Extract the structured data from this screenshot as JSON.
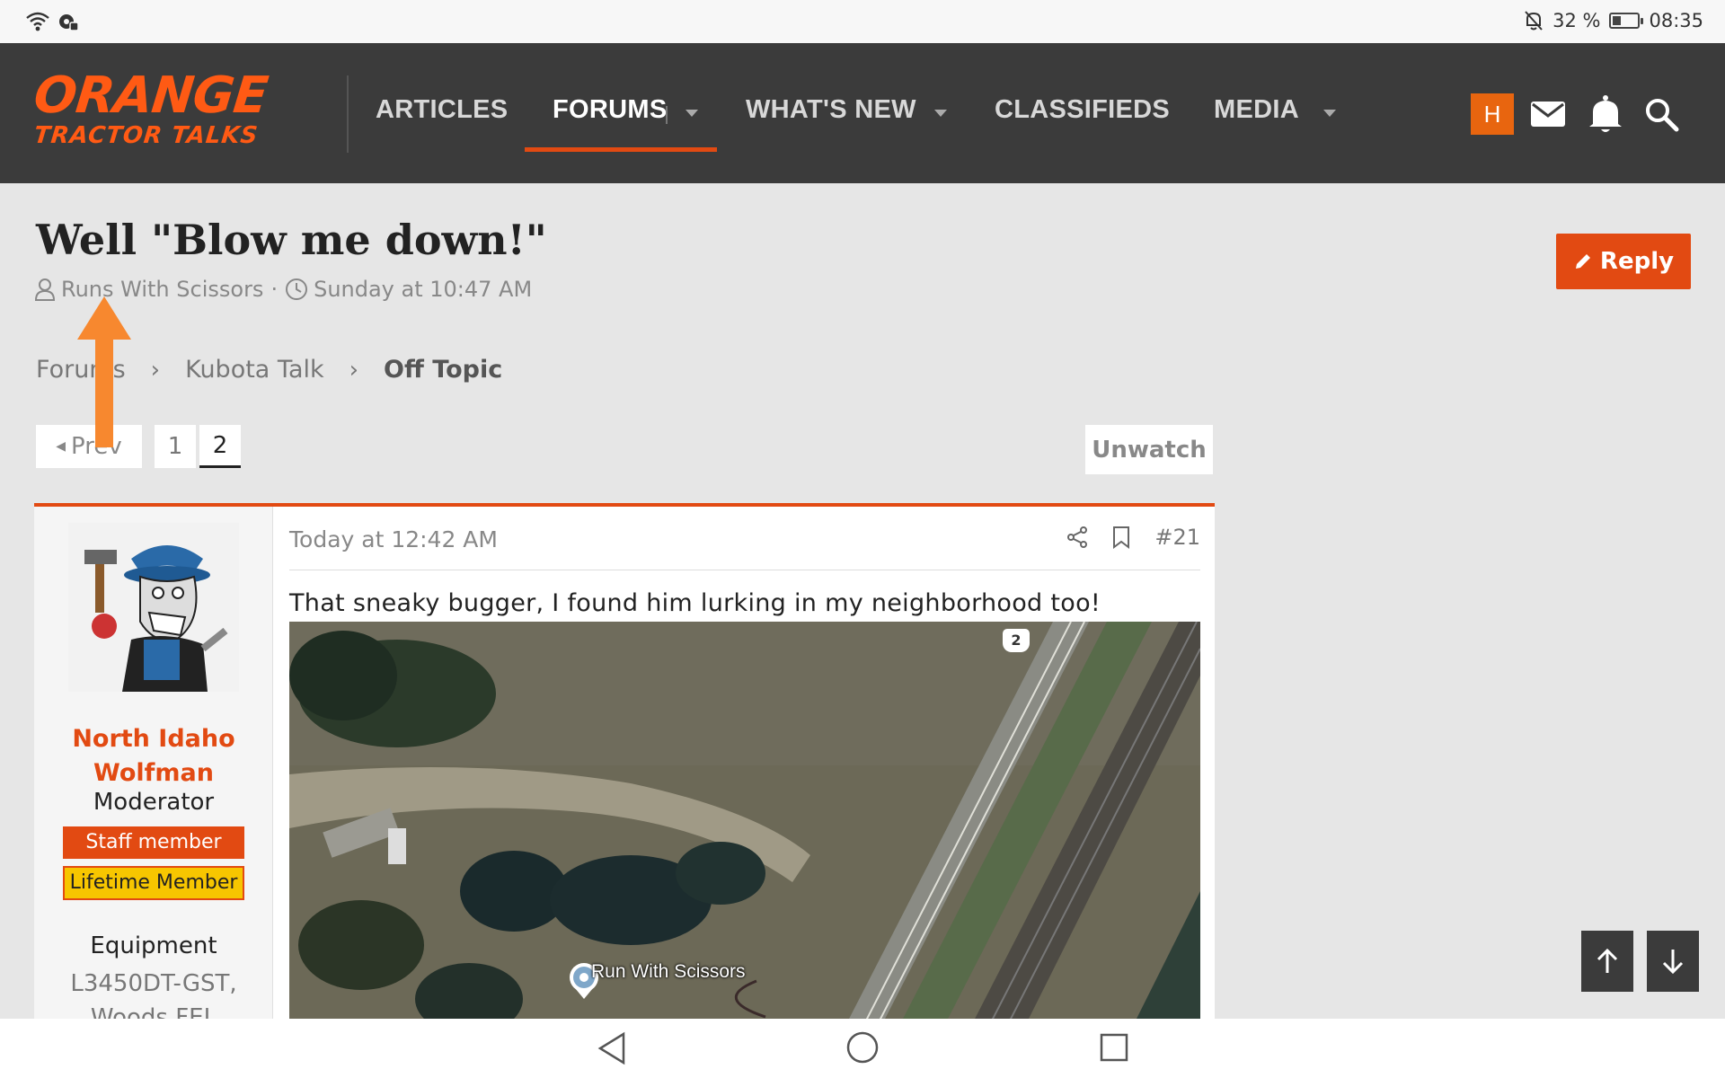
{
  "status_bar": {
    "battery_text": "32 %",
    "battery_level": 0.32,
    "time": "08:35"
  },
  "nav": {
    "logo_top": "ORANGE",
    "logo_bottom": "TRACTOR TALKS",
    "items": [
      {
        "label": "ARTICLES",
        "has_dropdown": false
      },
      {
        "label": "FORUMS",
        "has_dropdown": true,
        "active": true
      },
      {
        "label": "WHAT'S NEW",
        "has_dropdown": true
      },
      {
        "label": "CLASSIFIEDS",
        "has_dropdown": false
      },
      {
        "label": "MEDIA",
        "has_dropdown": true
      }
    ],
    "avatar_letter": "H",
    "icons": [
      "mail-icon",
      "bell-icon",
      "search-icon"
    ],
    "accent_color": "#e24a12"
  },
  "thread": {
    "title": "Well \"Blow me down!\"",
    "author": "Runs With Scissors",
    "separator": "·",
    "date": "Sunday at 10:47 AM",
    "reply_label": "Reply"
  },
  "breadcrumb": {
    "items": [
      "Forums",
      "Kubota Talk"
    ],
    "current": "Off Topic"
  },
  "pagination": {
    "prev_label": "Prev",
    "pages": [
      "1",
      "2"
    ],
    "current_page": "2",
    "unwatch_label": "Unwatch"
  },
  "post": {
    "user": {
      "name_line1": "North Idaho",
      "name_line2": "Wolfman",
      "role": "Moderator",
      "badge_staff": "Staff member",
      "badge_lifetime": "Lifetime Member",
      "equipment_label": "Equipment",
      "equipment_line1": "L3450DT-GST,",
      "equipment_line2": "Woods FEL"
    },
    "date": "Today at 12:42 AM",
    "number": "#21",
    "text": "That sneaky bugger, I found him lurking in my neighborhood too!",
    "map": {
      "pin_label": "Run With Scissors",
      "route_shield": "2"
    }
  }
}
